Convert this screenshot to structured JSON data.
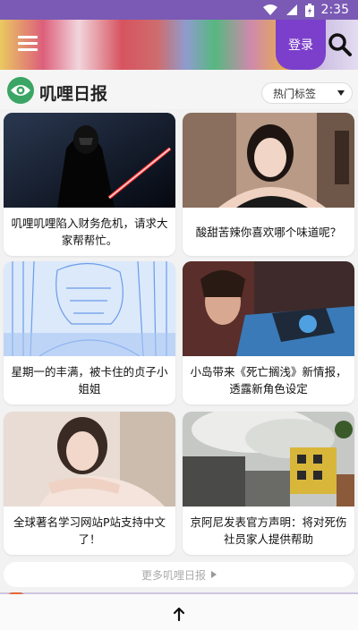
{
  "status_bar": {
    "time": "2:35",
    "icons": [
      "wifi-icon",
      "signal-icon",
      "battery-icon"
    ]
  },
  "header": {
    "menu_icon": "hamburger-menu-icon",
    "login_label": "登录",
    "search_icon": "search-icon"
  },
  "section": {
    "logo_icon": "eye-icon",
    "title": "叽哩日报",
    "tags_dropdown": {
      "selected": "热门标签"
    }
  },
  "cards": [
    {
      "caption": "叽哩叽哩陷入财务危机，请求大家帮帮忙。",
      "image": "sith-lord-lightsaber"
    },
    {
      "caption": "酸甜苦辣你喜欢哪个味道呢？",
      "image": "girl-portrait-room"
    },
    {
      "caption": "星期一的丰满，被卡住的贞子小姐姐",
      "image": "manga-sketch-blue"
    },
    {
      "caption": "小岛带来《死亡搁浅》新情报，透露新角色设定",
      "image": "game-character-armor"
    },
    {
      "caption": "全球著名学习网站P站支持中文了！",
      "image": "girl-portrait-lying"
    },
    {
      "caption": "京阿尼发表官方声明：将对死伤社员家人提供帮助",
      "image": "building-fire-smoke"
    }
  ],
  "more": {
    "label": "更多叽哩日报"
  },
  "bottom": {
    "icon": "arrow-up-icon"
  },
  "colors": {
    "accent": "#7b3fcb",
    "logo_green": "#3aa564",
    "status_bar": "#7a5ab5"
  }
}
